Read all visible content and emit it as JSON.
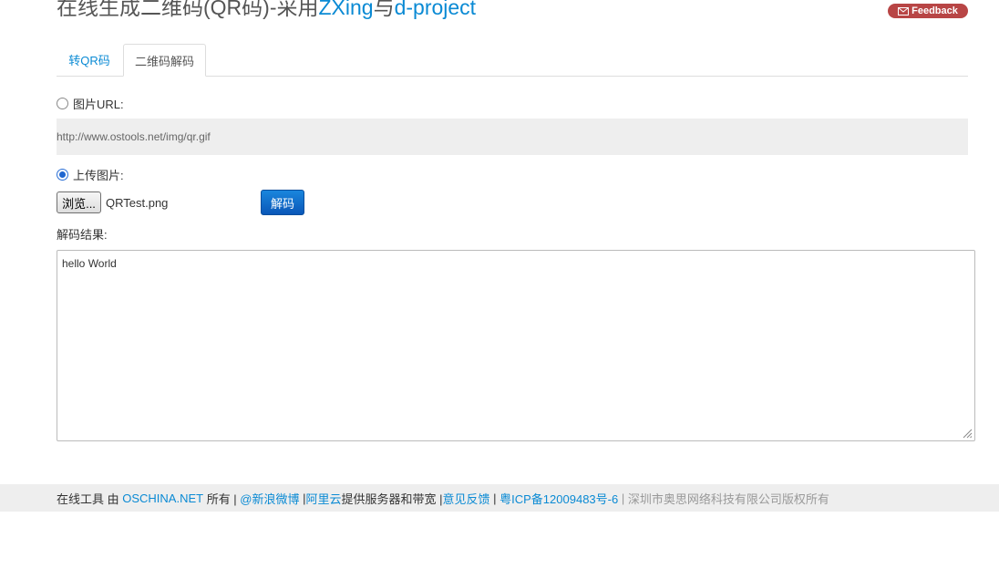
{
  "header": {
    "title_prefix": "在线生成二维码(QR码)-采用",
    "title_link1": "ZXing",
    "title_middle": "与",
    "title_link2": "d-project",
    "feedback_label": "Feedback",
    "feedback_icon": "envelope-icon"
  },
  "tabs": [
    {
      "label": "转QR码",
      "active": false
    },
    {
      "label": "二维码解码",
      "active": true
    }
  ],
  "form": {
    "url_option_label": "图片URL:",
    "url_option_checked": false,
    "url_value": "http://www.ostools.net/img/qr.gif",
    "upload_option_label": "上传图片:",
    "upload_option_checked": true,
    "browse_label": "浏览...",
    "file_name": "QRTest.png",
    "decode_button_label": "解码",
    "result_label": "解码结果:",
    "result_value": "hello World"
  },
  "footer": {
    "text1": "在线工具 由 ",
    "oschina": "OSCHINA.NET",
    "text2": " 所有 | ",
    "weibo": "@新浪微博",
    "text3": " |",
    "aliyun": "阿里云",
    "text4": "提供服务器和带宽 |",
    "feedback": "意见反馈",
    "text5": " | ",
    "icp": "粤ICP备12009483号-6",
    "text6": " | ",
    "copyright": "深圳市奥思网络科技有限公司版权所有"
  },
  "colors": {
    "link": "#0a8ad4",
    "feedback_bg": "#b84545",
    "decode_button": "#0a57b8",
    "footer_bg": "#eeeeee"
  }
}
